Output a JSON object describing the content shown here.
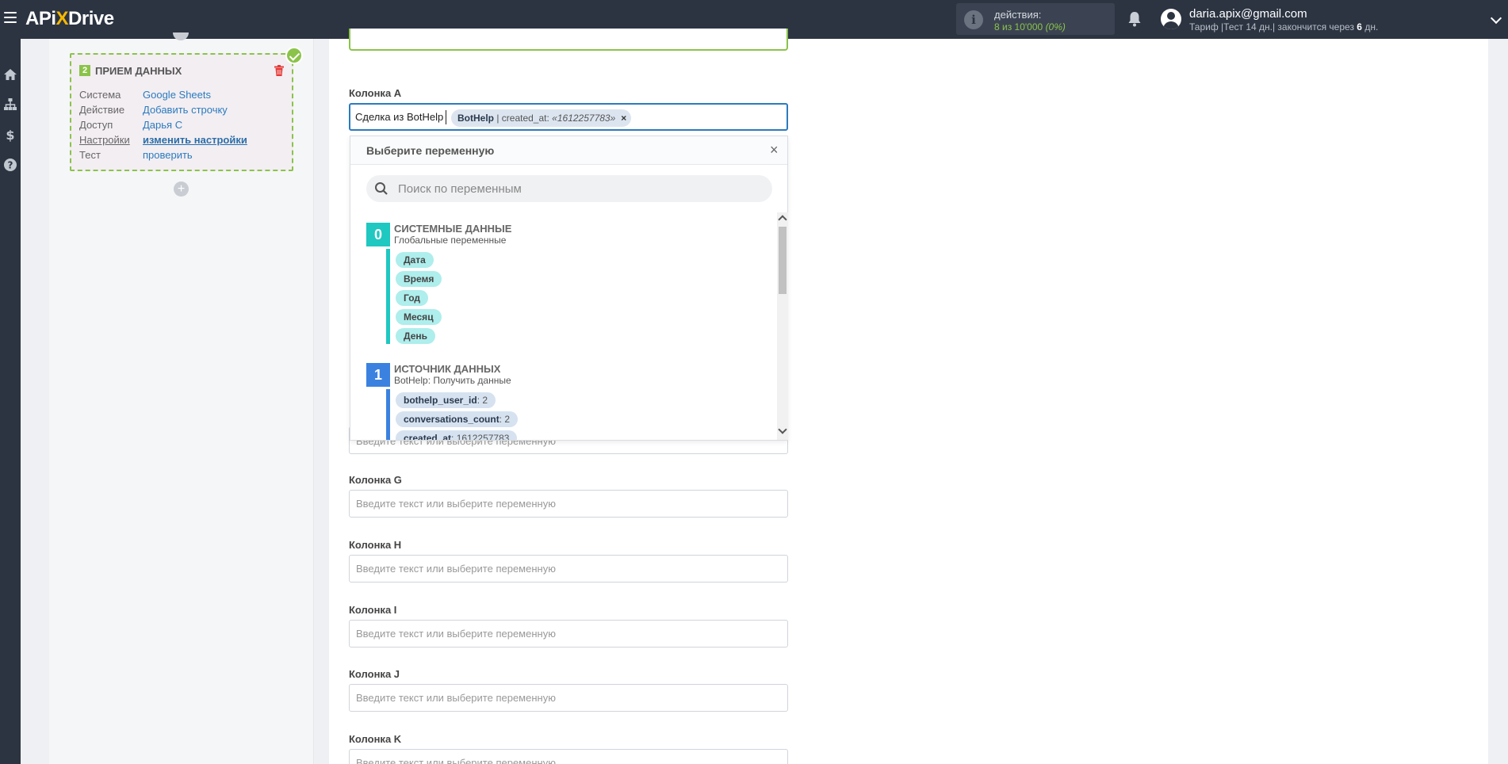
{
  "header": {
    "logo_left": "APi",
    "logo_x": "X",
    "logo_right": "Drive",
    "actions_label": "действия:",
    "actions_count": "8 из 10'000",
    "actions_pct": "(0%)",
    "user_email": "daria.apix@gmail.com",
    "tariff_prefix": "Тариф |Тест 14 дн.| закончится через",
    "tariff_days": "6",
    "tariff_suffix": "дн."
  },
  "card": {
    "number": "2",
    "title": "ПРИЕМ ДАННЫХ",
    "rows": [
      {
        "key": "Система",
        "value": "Google Sheets"
      },
      {
        "key": "Действие",
        "value": "Добавить строчку"
      },
      {
        "key": "Доступ",
        "value": "Дарья С"
      },
      {
        "key": "Настройки",
        "value": "изменить настройки"
      },
      {
        "key": "Тест",
        "value": "проверить"
      }
    ]
  },
  "add_symbol": "+",
  "field_a": {
    "label": "Колонка A",
    "text": "Сделка из BotHelp",
    "chip_source": "BotHelp",
    "chip_rest": " | created_at: ",
    "chip_value": "«1612257783»",
    "chip_remove": "×"
  },
  "dropdown": {
    "title": "Выберите переменную",
    "close": "×",
    "search_placeholder": "Поиск по переменным",
    "groups": [
      {
        "num": "0",
        "title": "СИСТЕМНЫЕ ДАННЫЕ",
        "subtitle": "Глобальные переменные",
        "color": "#1fc8c0",
        "vars": [
          {
            "name": "Дата"
          },
          {
            "name": "Время"
          },
          {
            "name": "Год"
          },
          {
            "name": "Месяц"
          },
          {
            "name": "День"
          }
        ]
      },
      {
        "num": "1",
        "title": "ИСТОЧНИК ДАННЫХ",
        "subtitle": "BotHelp: Получить данные",
        "color": "#3b82e0",
        "vars": [
          {
            "name": "bothelp_user_id",
            "value": ": 2"
          },
          {
            "name": "conversations_count",
            "value": ": 2"
          },
          {
            "name": "created_at",
            "value": ": 1612257783"
          }
        ]
      }
    ]
  },
  "hidden_field_placeholder": "Введите текст или выберите переменную",
  "fields": [
    {
      "label": "Колонка G",
      "placeholder": "Введите текст или выберите переменную"
    },
    {
      "label": "Колонка H",
      "placeholder": "Введите текст или выберите переменную"
    },
    {
      "label": "Колонка I",
      "placeholder": "Введите текст или выберите переменную"
    },
    {
      "label": "Колонка J",
      "placeholder": "Введите текст или выберите переменную"
    },
    {
      "label": "Колонка K",
      "placeholder": "Введите текст или выберите переменную"
    }
  ],
  "colors": {
    "topbar": "#2c3442",
    "accent_green": "#8bc34a",
    "link_blue": "#2b7bbf",
    "system_teal": "#1fc8c0",
    "source_blue": "#3b82e0"
  }
}
